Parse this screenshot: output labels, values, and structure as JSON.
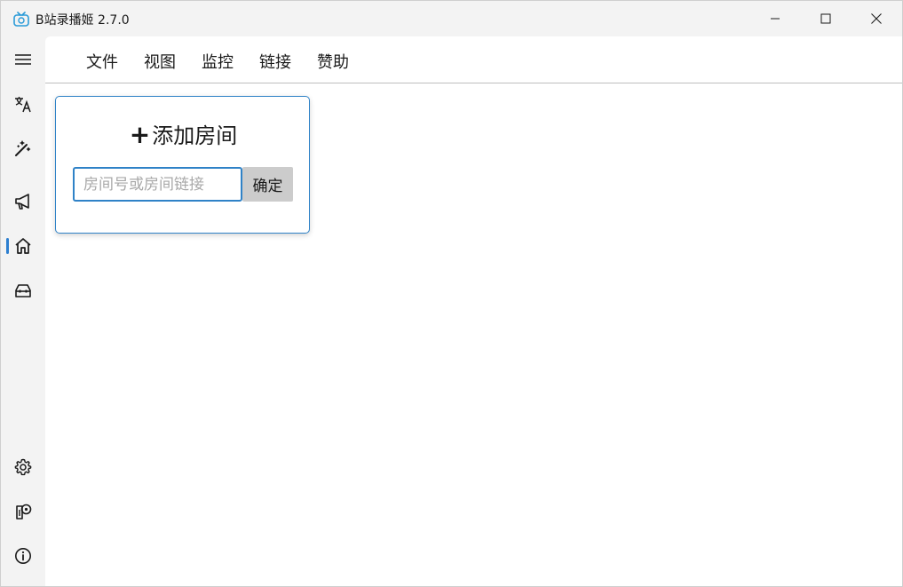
{
  "window": {
    "title": "B站录播姬 2.7.0"
  },
  "rail": {
    "items": [
      {
        "icon": "hamburger-menu-icon"
      },
      {
        "icon": "translate-icon"
      },
      {
        "icon": "magic-wand-icon"
      },
      {
        "icon": "megaphone-icon"
      },
      {
        "icon": "home-icon",
        "selected": true
      },
      {
        "icon": "toolbox-icon"
      },
      {
        "icon": "gear-icon"
      },
      {
        "icon": "pin-note-icon"
      },
      {
        "icon": "info-icon"
      }
    ]
  },
  "menu": {
    "file": "文件",
    "view": "视图",
    "monitor": "监控",
    "links": "链接",
    "sponsor": "赞助"
  },
  "add_room": {
    "plus": "+",
    "title": "添加房间",
    "input_value": "",
    "input_placeholder": "房间号或房间链接",
    "confirm_label": "确定"
  },
  "colors": {
    "accent": "#2f82c7",
    "button_bg": "#cccccc",
    "background": "#f3f3f3"
  }
}
